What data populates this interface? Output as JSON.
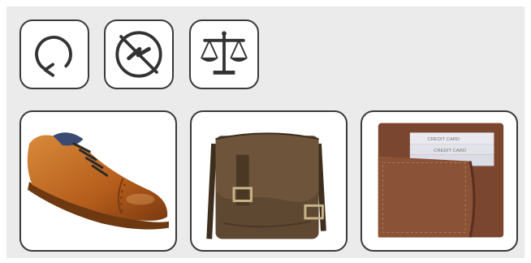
{
  "icons": [
    {
      "name": "refresh-icon"
    },
    {
      "name": "no-static-icon"
    },
    {
      "name": "scales-icon"
    }
  ],
  "products": [
    {
      "name": "oxford-shoe",
      "image": "tan-leather-oxford-brogue-shoe"
    },
    {
      "name": "messenger-bag",
      "image": "brown-leather-messenger-bag"
    },
    {
      "name": "wallet",
      "image": "brown-leather-bifold-wallet",
      "card_slot_texts": [
        "CREDIT CARD",
        "CREDIT CARD"
      ]
    }
  ],
  "colors": {
    "panel": "#ebebeb",
    "tile_border": "#3a3a3a",
    "icon_stroke": "#333333",
    "shoe_tan": "#b8601f",
    "bag_brown": "#5a4530",
    "wallet_brown": "#8a5236"
  }
}
